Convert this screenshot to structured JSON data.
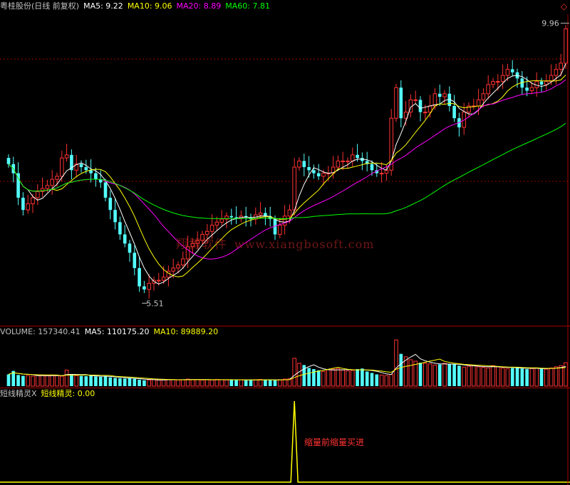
{
  "header": {
    "title": "粤桂股份(日线 前复权)",
    "ma5": "MA5: 9.22",
    "ma10": "MA10: 9.06",
    "ma20": "MA20: 8.89",
    "ma60": "MA60: 7.81"
  },
  "watermark": {
    "name": "翔博软件",
    "url": "www.xiangbosoft.com"
  },
  "price_labels": {
    "high": "9.96",
    "low": "5.51"
  },
  "volume_header": {
    "volume": "VOLUME: 157340.41",
    "ma5": "MA5: 110175.20",
    "ma10": "MA10: 89889.20"
  },
  "indicator_header": {
    "name": "短线精灵X",
    "series": "短线精灵: 0.00"
  },
  "indicator_annotation": "缩量前缩量买进",
  "colors": {
    "up": "#ff3232",
    "down": "#54ffff",
    "ma5": "#ffffff",
    "ma10": "#ffff00",
    "ma20": "#ff00ff",
    "ma60": "#00ff00",
    "separator": "#a00000",
    "spike": "#ffff00"
  },
  "chart_data": [
    {
      "type": "candlestick",
      "title": "粤桂股份(日线 前复权)",
      "approximate": true,
      "ylim": [
        5.2,
        10.2
      ],
      "opens": [
        7.85,
        7.75,
        7.6,
        7.2,
        7.0,
        7.1,
        7.2,
        7.3,
        7.35,
        7.4,
        7.5,
        7.55,
        7.85,
        7.9,
        7.65,
        7.75,
        7.7,
        7.65,
        7.6,
        7.5,
        7.45,
        7.2,
        7.0,
        6.8,
        6.6,
        6.45,
        6.3,
        6.05,
        5.75,
        5.7,
        5.8,
        5.85,
        5.85,
        5.9,
        6.0,
        6.05,
        6.1,
        6.2,
        6.4,
        6.45,
        6.5,
        6.6,
        6.65,
        6.75,
        6.8,
        6.85,
        6.9,
        6.88,
        6.86,
        6.9,
        6.88,
        6.85,
        6.92,
        6.95,
        6.9,
        6.85,
        6.6,
        6.75,
        6.9,
        7.0,
        7.7,
        7.8,
        7.7,
        7.65,
        7.6,
        7.55,
        7.6,
        7.6,
        7.7,
        7.8,
        7.8,
        7.8,
        7.9,
        7.85,
        7.8,
        7.75,
        7.65,
        7.6,
        7.6,
        7.65,
        8.5,
        9.0,
        8.5,
        8.6,
        8.8,
        8.8,
        8.6,
        8.6,
        8.7,
        8.9,
        8.85,
        8.9,
        8.7,
        8.5,
        8.35,
        8.6,
        8.7,
        8.7,
        8.8,
        8.9,
        9.05,
        9.1,
        9.1,
        9.2,
        9.3,
        9.25,
        9.15,
        9.0,
        8.95,
        9.0,
        9.1,
        9.05,
        9.1,
        9.2,
        9.3,
        9.4
      ],
      "closes": [
        7.75,
        7.6,
        7.2,
        7.0,
        7.1,
        7.2,
        7.3,
        7.35,
        7.4,
        7.5,
        7.55,
        7.85,
        7.9,
        7.65,
        7.75,
        7.7,
        7.65,
        7.6,
        7.5,
        7.45,
        7.2,
        7.0,
        6.8,
        6.6,
        6.45,
        6.3,
        6.05,
        5.75,
        5.7,
        5.8,
        5.85,
        5.85,
        5.9,
        6.0,
        6.05,
        6.1,
        6.2,
        6.4,
        6.45,
        6.5,
        6.6,
        6.65,
        6.75,
        6.8,
        6.85,
        6.9,
        6.88,
        6.86,
        6.9,
        6.88,
        6.85,
        6.92,
        6.95,
        6.9,
        6.85,
        6.6,
        6.75,
        6.9,
        7.0,
        7.7,
        7.8,
        7.7,
        7.65,
        7.6,
        7.55,
        7.6,
        7.6,
        7.7,
        7.8,
        7.8,
        7.8,
        7.9,
        7.85,
        7.8,
        7.75,
        7.65,
        7.6,
        7.6,
        7.65,
        8.5,
        9.0,
        8.5,
        8.6,
        8.8,
        8.8,
        8.6,
        8.6,
        8.7,
        8.9,
        8.85,
        8.9,
        8.7,
        8.5,
        8.35,
        8.6,
        8.7,
        8.7,
        8.8,
        8.9,
        9.05,
        9.1,
        9.1,
        9.2,
        9.3,
        9.25,
        9.15,
        9.0,
        8.95,
        9.0,
        9.1,
        9.05,
        9.1,
        9.2,
        9.3,
        9.4,
        9.96
      ],
      "series": [
        {
          "name": "MA5"
        },
        {
          "name": "MA10"
        },
        {
          "name": "MA20"
        },
        {
          "name": "MA60"
        }
      ],
      "annotations": [
        {
          "text": "9.96",
          "x": 116,
          "y": 9.96
        },
        {
          "text": "5.51",
          "x": 29,
          "y": 5.51
        }
      ]
    },
    {
      "type": "bar",
      "title": "VOLUME",
      "approximate": true,
      "ylim": [
        0,
        160000
      ],
      "values": [
        40000,
        52000,
        38000,
        35000,
        36000,
        34000,
        37000,
        36000,
        35000,
        38000,
        36000,
        34000,
        55000,
        38000,
        36000,
        35000,
        34000,
        36000,
        33000,
        32000,
        34000,
        30000,
        28000,
        27000,
        26000,
        27000,
        25000,
        22000,
        20000,
        21000,
        22000,
        21000,
        22000,
        23000,
        22000,
        21000,
        22000,
        24000,
        23000,
        22000,
        21000,
        22000,
        21000,
        23000,
        22000,
        21000,
        22000,
        21000,
        22000,
        20000,
        21000,
        22000,
        23000,
        22000,
        21000,
        20000,
        22000,
        24000,
        26000,
        95000,
        78000,
        72000,
        62000,
        58000,
        54000,
        50000,
        56000,
        58000,
        60000,
        55000,
        52000,
        54000,
        58000,
        60000,
        50000,
        45000,
        40000,
        38000,
        36000,
        40000,
        157340,
        110000,
        100000,
        90000,
        85000,
        80000,
        78000,
        76000,
        72000,
        74000,
        78000,
        76000,
        74000,
        70000,
        65000,
        68000,
        70000,
        66000,
        64000,
        62000,
        70000,
        66000,
        62000,
        60000,
        62000,
        64000,
        60000,
        58000,
        60000,
        62000,
        60000,
        58000,
        62000,
        66000,
        70000,
        80000
      ],
      "series": [
        {
          "name": "VOLUME"
        },
        {
          "name": "MA5"
        },
        {
          "name": "MA10"
        }
      ]
    },
    {
      "type": "line",
      "title": "短线精灵X",
      "approximate": true,
      "ylim": [
        0,
        1
      ],
      "series": [
        {
          "name": "短线精灵"
        }
      ],
      "values": [
        0,
        0,
        0,
        0,
        0,
        0,
        0,
        0,
        0,
        0,
        0,
        0,
        0,
        0,
        0,
        0,
        0,
        0,
        0,
        0,
        0,
        0,
        0,
        0,
        0,
        0,
        0,
        0,
        0,
        0,
        0,
        0,
        0,
        0,
        0,
        0,
        0,
        0,
        0,
        0,
        0,
        0,
        0,
        0,
        0,
        0,
        0,
        0,
        0,
        0,
        0,
        0,
        0,
        0,
        0,
        0,
        0,
        0,
        0,
        1,
        0,
        0,
        0,
        0,
        0,
        0,
        0,
        0,
        0,
        0,
        0,
        0,
        0,
        0,
        0,
        0,
        0,
        0,
        0,
        0,
        0,
        0,
        0,
        0,
        0,
        0,
        0,
        0,
        0,
        0,
        0,
        0,
        0,
        0,
        0,
        0,
        0,
        0,
        0,
        0,
        0,
        0,
        0,
        0,
        0,
        0,
        0,
        0,
        0,
        0,
        0,
        0,
        0,
        0,
        0,
        0,
        0,
        0,
        0,
        0
      ]
    }
  ]
}
